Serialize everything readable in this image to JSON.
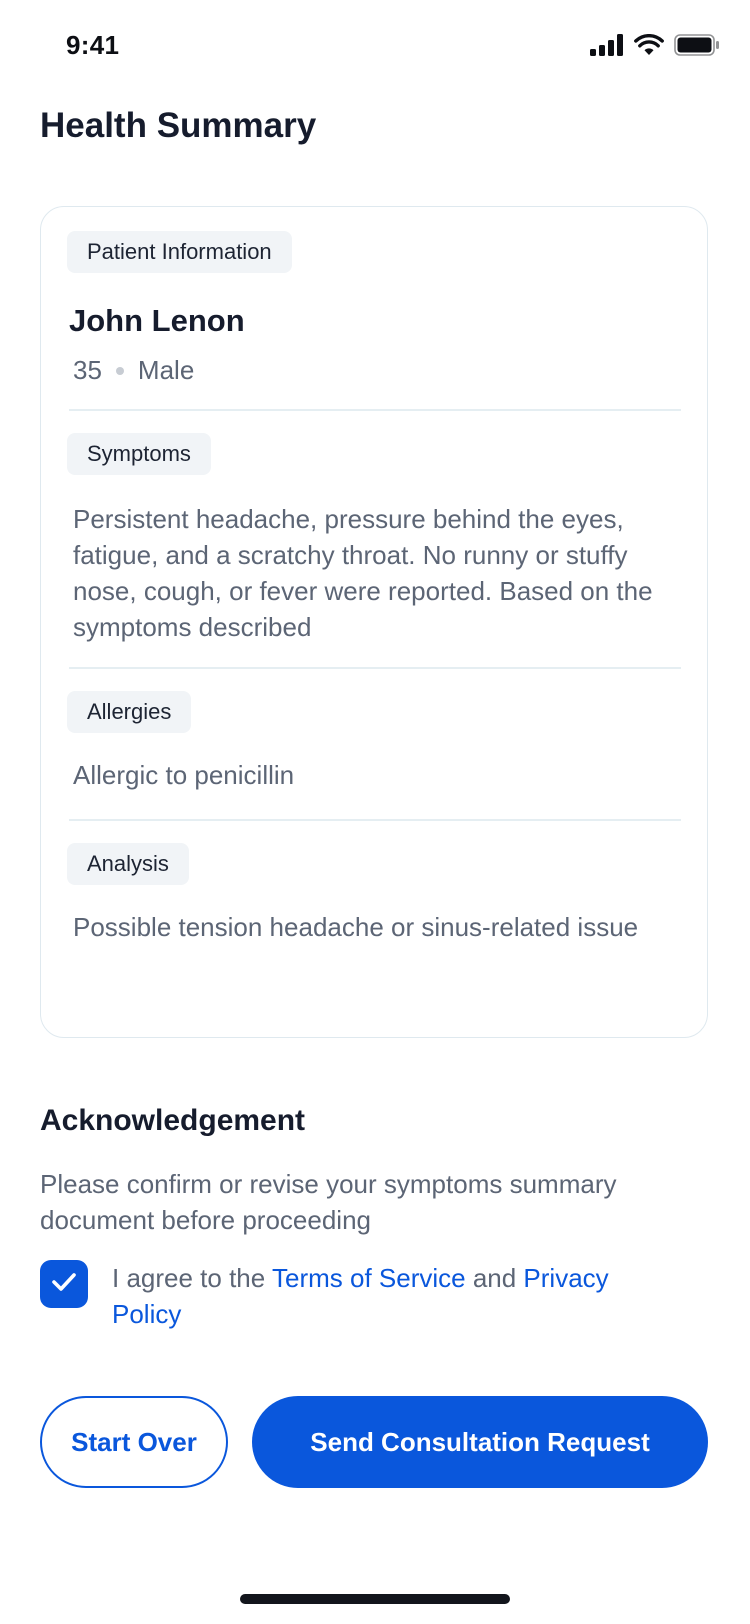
{
  "status_bar": {
    "time": "9:41",
    "icons": [
      "cellular-signal-icon",
      "wifi-icon",
      "battery-icon"
    ]
  },
  "page": {
    "title": "Health Summary"
  },
  "summary_card": {
    "patient_info": {
      "chip_label": "Patient Information",
      "name": "John Lenon",
      "age": "35",
      "sex": "Male"
    },
    "symptoms": {
      "chip_label": "Symptoms",
      "text": "Persistent headache, pressure behind the eyes, fatigue, and a scratchy throat. No runny or stuffy nose, cough, or fever were reported. Based on the symptoms described"
    },
    "allergies": {
      "chip_label": "Allergies",
      "text": "Allergic to penicillin"
    },
    "analysis": {
      "chip_label": "Analysis",
      "text": "Possible tension headache or sinus-related issue"
    }
  },
  "acknowledgement": {
    "title": "Acknowledgement",
    "description": "Please confirm or revise your symptoms summary document before proceeding",
    "checkbox_checked": true,
    "agree_prefix": "I agree to the ",
    "terms_link": "Terms of Service",
    "agree_middle": " and ",
    "privacy_link": "Privacy Policy"
  },
  "actions": {
    "start_over_label": "Start Over",
    "send_label": "Send Consultation Request"
  },
  "colors": {
    "primary": "#0a57dc",
    "text_dark": "#161c2d",
    "text_muted": "#5c6575",
    "chip_bg": "#f1f4f7",
    "card_border": "#dfe9ef"
  }
}
